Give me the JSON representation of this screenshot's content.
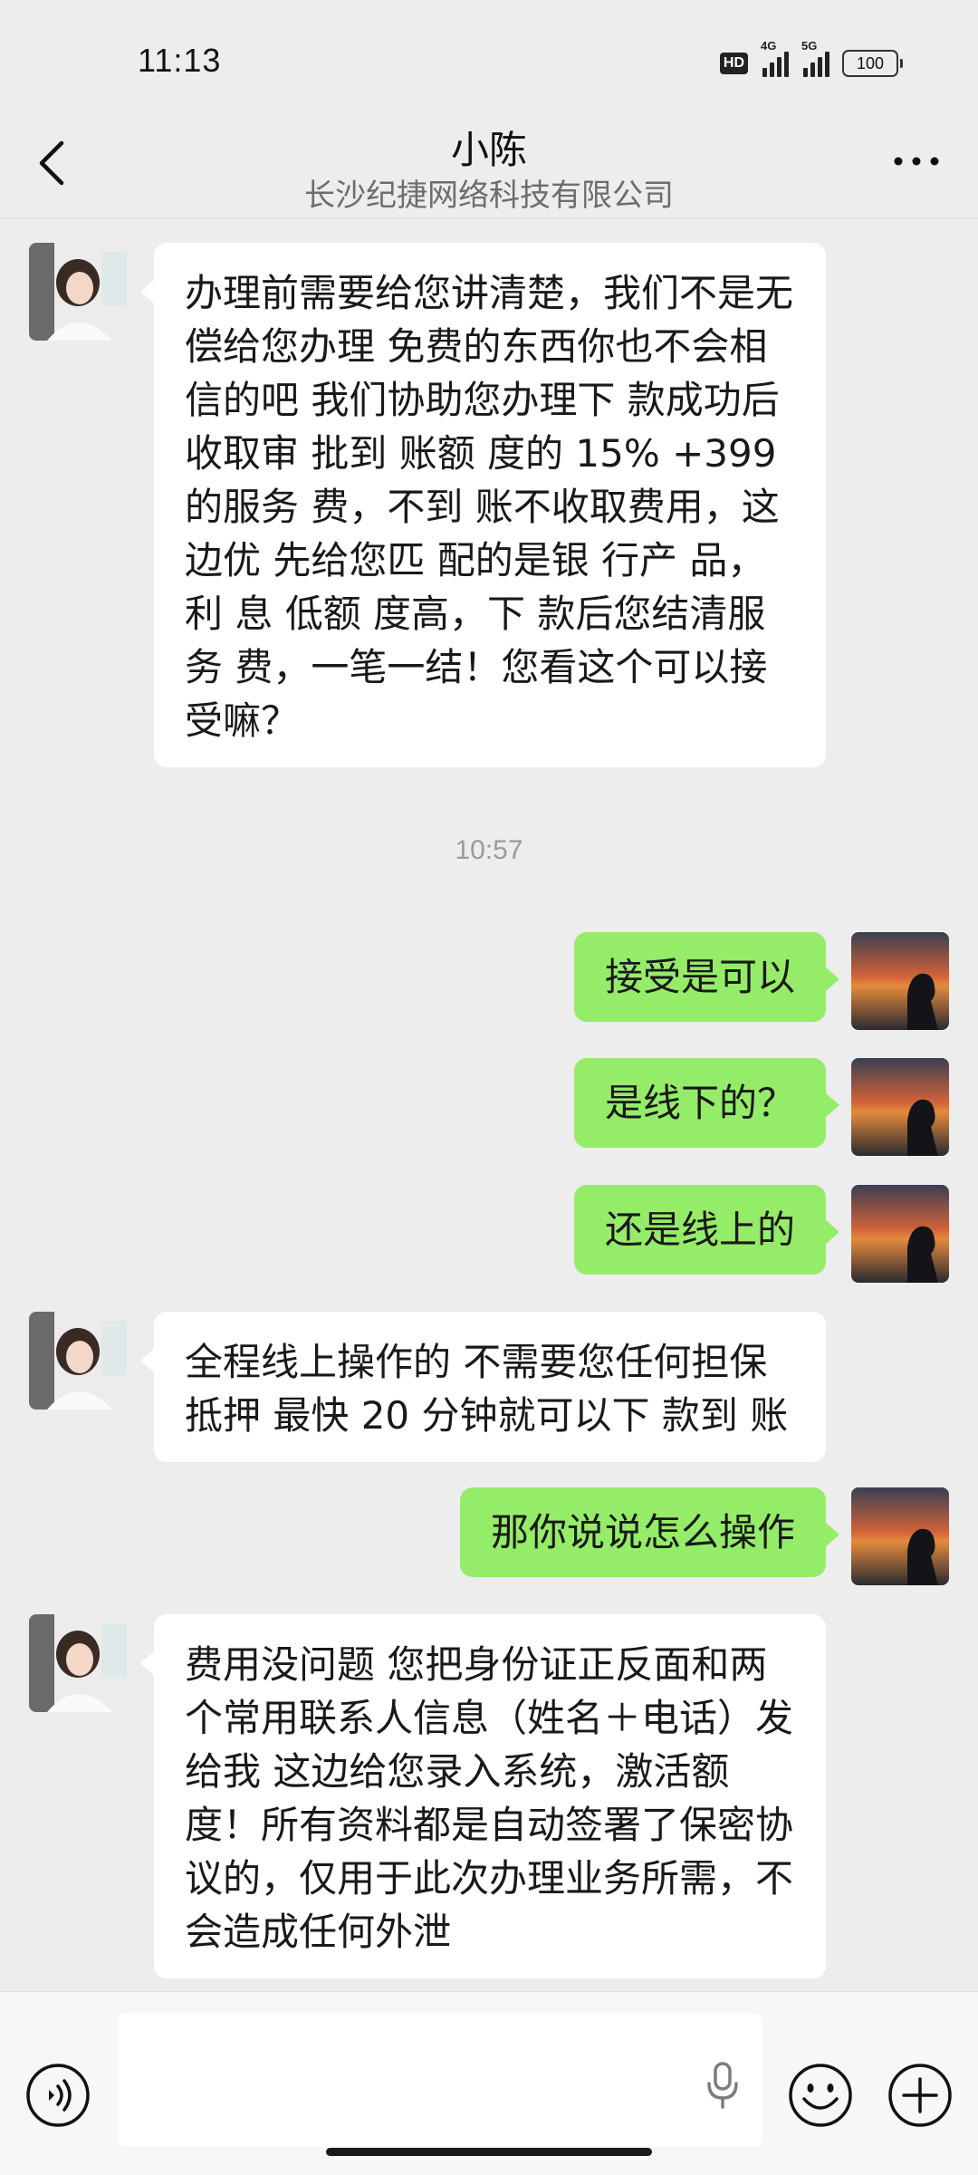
{
  "status_bar": {
    "time": "11:13",
    "hd": "HD",
    "network_1": "4G",
    "network_2": "5G",
    "battery": "100"
  },
  "header": {
    "title": "小陈",
    "subtitle": "长沙纪捷网络科技有限公司"
  },
  "messages": [
    {
      "side": "left",
      "text": "办理前需要给您讲清楚，我们不是无偿给您办理 免费的东西你也不会相信的吧  我们协助您办理下 款成功后收取审 批到 账额 度的 15% +399 的服务 费，不到 账不收取费用，这边优 先给您匹 配的是银 行产 品，利 息 低额 度高，下 款后您结清服 务 费，一笔一结！您看这个可以接受嘛？"
    },
    {
      "side": "right",
      "text": "接受是可以"
    },
    {
      "side": "right",
      "text": "是线下的？"
    },
    {
      "side": "right",
      "text": "还是线上的"
    },
    {
      "side": "left",
      "text": "全程线上操作的 不需要您任何担保抵押 最快 20 分钟就可以下 款到 账"
    },
    {
      "side": "right",
      "text": "那你说说怎么操作"
    },
    {
      "side": "left",
      "text": "费用没问题  您把身份证正反面和两个常用联系人信息（姓名＋电话）发给我  这边给您录入系统，激活额 度！所有资料都是自动签署了保密协议的，仅用于此次办理业务所需，不会造成任何外泄"
    }
  ],
  "time_separator": "10:57",
  "input": {
    "value": ""
  },
  "colors": {
    "background": "#ededed",
    "sent_bubble": "#95ec69",
    "received_bubble": "#ffffff"
  },
  "icons": {
    "back": "chevron-left-icon",
    "more": "more-dots-icon",
    "voice": "voice-icon",
    "mic": "microphone-icon",
    "emoji": "emoji-icon",
    "plus": "plus-icon"
  }
}
